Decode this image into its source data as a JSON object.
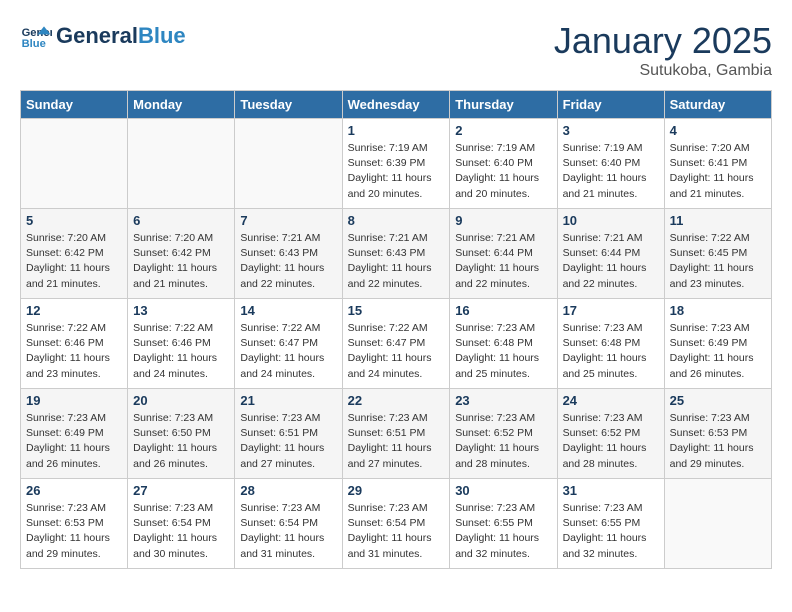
{
  "header": {
    "logo_line1": "General",
    "logo_line2": "Blue",
    "month": "January 2025",
    "location": "Sutukoba, Gambia"
  },
  "weekdays": [
    "Sunday",
    "Monday",
    "Tuesday",
    "Wednesday",
    "Thursday",
    "Friday",
    "Saturday"
  ],
  "weeks": [
    [
      {
        "day": "",
        "info": ""
      },
      {
        "day": "",
        "info": ""
      },
      {
        "day": "",
        "info": ""
      },
      {
        "day": "1",
        "info": "Sunrise: 7:19 AM\nSunset: 6:39 PM\nDaylight: 11 hours and 20 minutes."
      },
      {
        "day": "2",
        "info": "Sunrise: 7:19 AM\nSunset: 6:40 PM\nDaylight: 11 hours and 20 minutes."
      },
      {
        "day": "3",
        "info": "Sunrise: 7:19 AM\nSunset: 6:40 PM\nDaylight: 11 hours and 21 minutes."
      },
      {
        "day": "4",
        "info": "Sunrise: 7:20 AM\nSunset: 6:41 PM\nDaylight: 11 hours and 21 minutes."
      }
    ],
    [
      {
        "day": "5",
        "info": "Sunrise: 7:20 AM\nSunset: 6:42 PM\nDaylight: 11 hours and 21 minutes."
      },
      {
        "day": "6",
        "info": "Sunrise: 7:20 AM\nSunset: 6:42 PM\nDaylight: 11 hours and 21 minutes."
      },
      {
        "day": "7",
        "info": "Sunrise: 7:21 AM\nSunset: 6:43 PM\nDaylight: 11 hours and 22 minutes."
      },
      {
        "day": "8",
        "info": "Sunrise: 7:21 AM\nSunset: 6:43 PM\nDaylight: 11 hours and 22 minutes."
      },
      {
        "day": "9",
        "info": "Sunrise: 7:21 AM\nSunset: 6:44 PM\nDaylight: 11 hours and 22 minutes."
      },
      {
        "day": "10",
        "info": "Sunrise: 7:21 AM\nSunset: 6:44 PM\nDaylight: 11 hours and 22 minutes."
      },
      {
        "day": "11",
        "info": "Sunrise: 7:22 AM\nSunset: 6:45 PM\nDaylight: 11 hours and 23 minutes."
      }
    ],
    [
      {
        "day": "12",
        "info": "Sunrise: 7:22 AM\nSunset: 6:46 PM\nDaylight: 11 hours and 23 minutes."
      },
      {
        "day": "13",
        "info": "Sunrise: 7:22 AM\nSunset: 6:46 PM\nDaylight: 11 hours and 24 minutes."
      },
      {
        "day": "14",
        "info": "Sunrise: 7:22 AM\nSunset: 6:47 PM\nDaylight: 11 hours and 24 minutes."
      },
      {
        "day": "15",
        "info": "Sunrise: 7:22 AM\nSunset: 6:47 PM\nDaylight: 11 hours and 24 minutes."
      },
      {
        "day": "16",
        "info": "Sunrise: 7:23 AM\nSunset: 6:48 PM\nDaylight: 11 hours and 25 minutes."
      },
      {
        "day": "17",
        "info": "Sunrise: 7:23 AM\nSunset: 6:48 PM\nDaylight: 11 hours and 25 minutes."
      },
      {
        "day": "18",
        "info": "Sunrise: 7:23 AM\nSunset: 6:49 PM\nDaylight: 11 hours and 26 minutes."
      }
    ],
    [
      {
        "day": "19",
        "info": "Sunrise: 7:23 AM\nSunset: 6:49 PM\nDaylight: 11 hours and 26 minutes."
      },
      {
        "day": "20",
        "info": "Sunrise: 7:23 AM\nSunset: 6:50 PM\nDaylight: 11 hours and 26 minutes."
      },
      {
        "day": "21",
        "info": "Sunrise: 7:23 AM\nSunset: 6:51 PM\nDaylight: 11 hours and 27 minutes."
      },
      {
        "day": "22",
        "info": "Sunrise: 7:23 AM\nSunset: 6:51 PM\nDaylight: 11 hours and 27 minutes."
      },
      {
        "day": "23",
        "info": "Sunrise: 7:23 AM\nSunset: 6:52 PM\nDaylight: 11 hours and 28 minutes."
      },
      {
        "day": "24",
        "info": "Sunrise: 7:23 AM\nSunset: 6:52 PM\nDaylight: 11 hours and 28 minutes."
      },
      {
        "day": "25",
        "info": "Sunrise: 7:23 AM\nSunset: 6:53 PM\nDaylight: 11 hours and 29 minutes."
      }
    ],
    [
      {
        "day": "26",
        "info": "Sunrise: 7:23 AM\nSunset: 6:53 PM\nDaylight: 11 hours and 29 minutes."
      },
      {
        "day": "27",
        "info": "Sunrise: 7:23 AM\nSunset: 6:54 PM\nDaylight: 11 hours and 30 minutes."
      },
      {
        "day": "28",
        "info": "Sunrise: 7:23 AM\nSunset: 6:54 PM\nDaylight: 11 hours and 31 minutes."
      },
      {
        "day": "29",
        "info": "Sunrise: 7:23 AM\nSunset: 6:54 PM\nDaylight: 11 hours and 31 minutes."
      },
      {
        "day": "30",
        "info": "Sunrise: 7:23 AM\nSunset: 6:55 PM\nDaylight: 11 hours and 32 minutes."
      },
      {
        "day": "31",
        "info": "Sunrise: 7:23 AM\nSunset: 6:55 PM\nDaylight: 11 hours and 32 minutes."
      },
      {
        "day": "",
        "info": ""
      }
    ]
  ]
}
